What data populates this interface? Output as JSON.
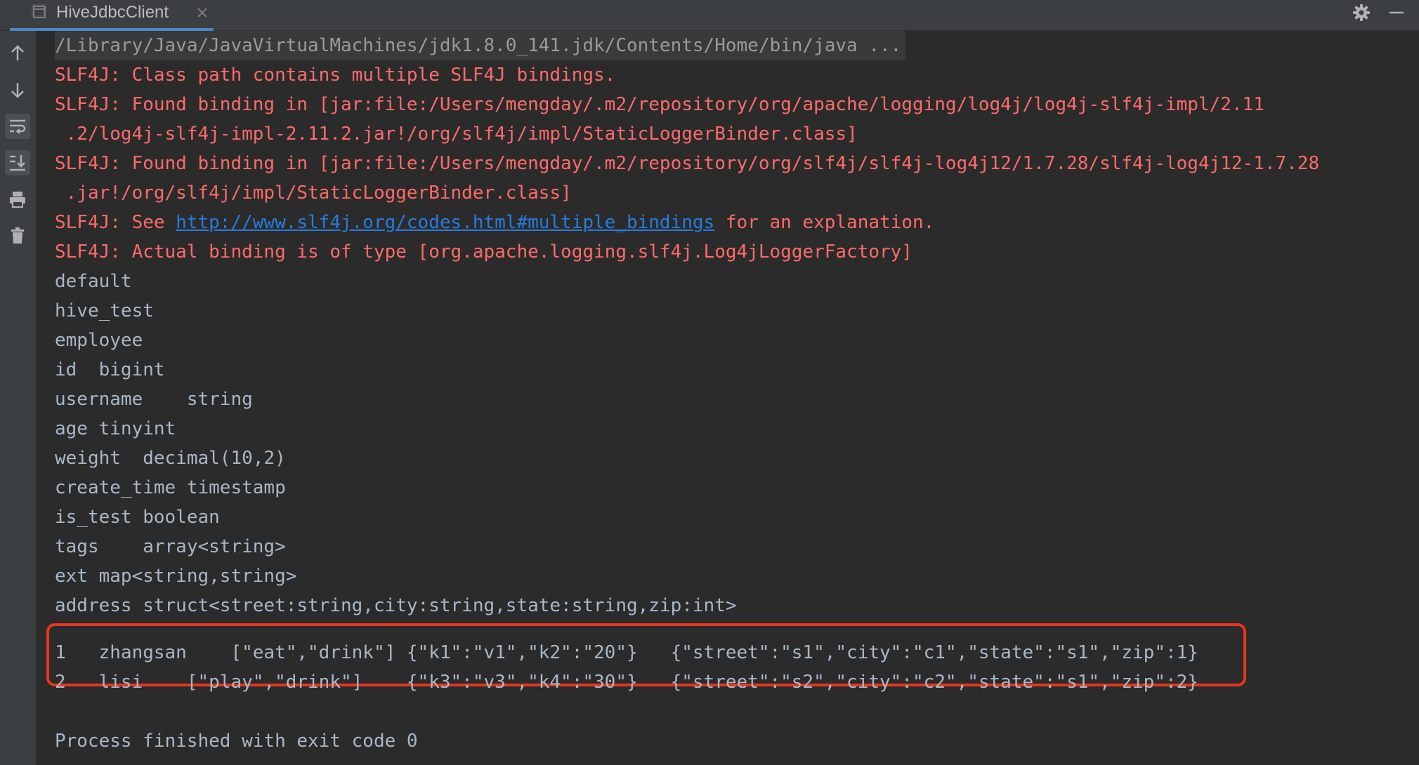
{
  "tab": {
    "title": "HiveJdbcClient"
  },
  "icons": {
    "tab": "console-tab-icon",
    "close": "close-icon",
    "settings": "gear-icon",
    "minimize": "minimize-icon"
  },
  "toolbar": [
    {
      "name": "up-arrow-icon",
      "active": false
    },
    {
      "name": "down-arrow-icon",
      "active": false
    },
    {
      "name": "soft-wrap-icon",
      "active": true
    },
    {
      "name": "scroll-to-end-icon",
      "active": true
    },
    {
      "name": "print-icon",
      "active": false
    },
    {
      "name": "trash-icon",
      "active": false
    }
  ],
  "console": {
    "command": "/Library/Java/JavaVirtualMachines/jdk1.8.0_141.jdk/Contents/Home/bin/java ...",
    "errors": [
      "SLF4J: Class path contains multiple SLF4J bindings.",
      "SLF4J: Found binding in [jar:file:/Users/mengday/.m2/repository/org/apache/logging/log4j/log4j-slf4j-impl/2.11",
      " .2/log4j-slf4j-impl-2.11.2.jar!/org/slf4j/impl/StaticLoggerBinder.class]",
      "SLF4J: Found binding in [jar:file:/Users/mengday/.m2/repository/org/slf4j/slf4j-log4j12/1.7.28/slf4j-log4j12-1.7.28",
      " .jar!/org/slf4j/impl/StaticLoggerBinder.class]"
    ],
    "see_prefix": "SLF4J: See ",
    "see_link": "http://www.slf4j.org/codes.html#multiple_bindings",
    "see_suffix": " for an explanation.",
    "actual_binding": "SLF4J: Actual binding is of type [org.apache.logging.slf4j.Log4jLoggerFactory]",
    "output": [
      "default",
      "hive_test",
      "employee",
      "id  bigint",
      "username    string",
      "age tinyint",
      "weight  decimal(10,2)",
      "create_time timestamp",
      "is_test boolean",
      "tags    array<string>",
      "ext map<string,string>",
      "address struct<street:string,city:string,state:string,zip:int>"
    ],
    "rows": [
      "1   zhangsan    [\"eat\",\"drink\"] {\"k1\":\"v1\",\"k2\":\"20\"}   {\"street\":\"s1\",\"city\":\"c1\",\"state\":\"s1\",\"zip\":1}",
      "2   lisi    [\"play\",\"drink\"]    {\"k3\":\"v3\",\"k4\":\"30\"}   {\"street\":\"s2\",\"city\":\"c2\",\"state\":\"s1\",\"zip\":2}"
    ],
    "exit": "Process finished with exit code 0"
  },
  "colors": {
    "background": "#2b2b2b",
    "toolbar": "#3c3f41",
    "error": "#ff6b68",
    "text": "#a9b7c6",
    "link": "#287bde",
    "highlight": "#e8351f",
    "tab_underline": "#4a88c7"
  }
}
